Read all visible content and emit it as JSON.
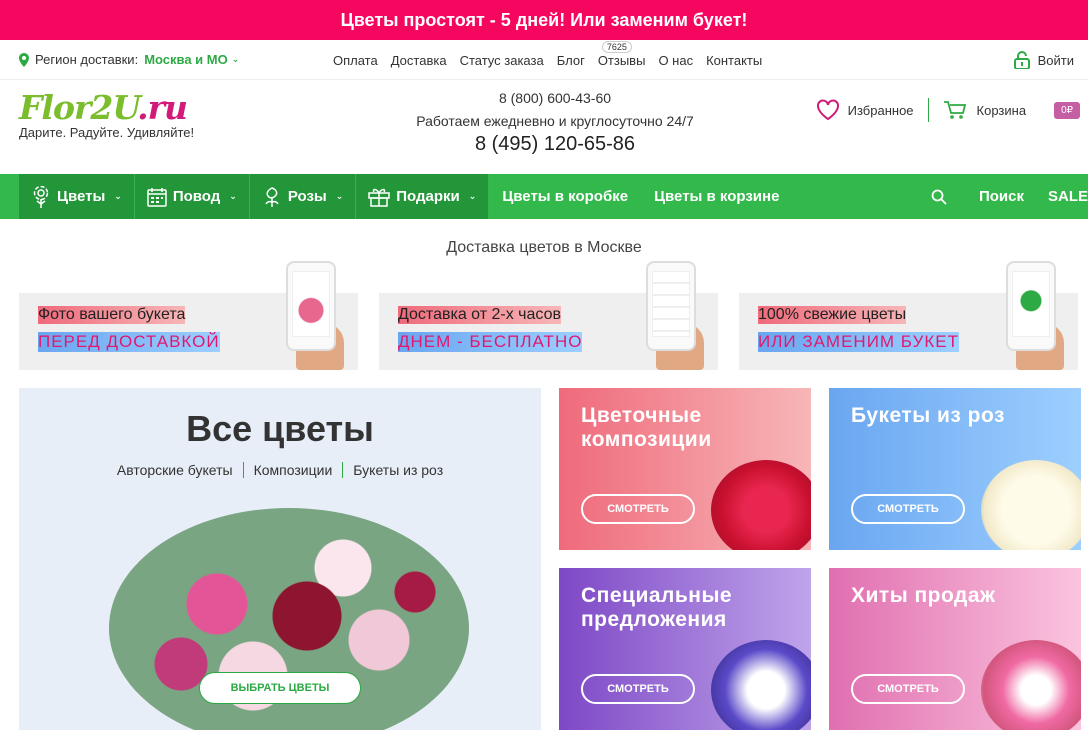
{
  "promo": {
    "text": "Цветы простоят - 5 дней! Или заменим букет!"
  },
  "topbar": {
    "region_label": "Регион доставки:",
    "region_value": "Москва и МО",
    "nav": [
      "Оплата",
      "Доставка",
      "Статус заказа",
      "Блог",
      "Отзывы",
      "О нас",
      "Контакты"
    ],
    "reviews_count": "7625",
    "login": "Войти"
  },
  "header": {
    "logo_main": "Flor2U",
    "logo_suffix": ".ru",
    "slogan": "Дарите. Радуйте. Удивляйте!",
    "phone_free": "8 (800) 600-43-60",
    "hours": "Работаем ежедневно и круглосуточно 24/7",
    "phone_main": "8 (495) 120-65-86",
    "favorites": "Избранное",
    "cart": "Корзина",
    "cart_total": "0₽"
  },
  "mainnav": {
    "items": [
      "Цветы",
      "Повод",
      "Розы",
      "Подарки"
    ],
    "plain": [
      "Цветы в коробке",
      "Цветы в корзине"
    ],
    "search": "Поиск",
    "sale": "SALE"
  },
  "page": {
    "subtitle": "Доставка цветов в Москве"
  },
  "features": [
    {
      "line1": "Фото вашего букета",
      "line2": "ПЕРЕД ДОСТАВКОЙ"
    },
    {
      "line1": "Доставка от 2-х часов",
      "line2": "ДНЕМ - БЕСПЛАТНО"
    },
    {
      "line1": "100% свежие цветы",
      "line2": "ИЛИ ЗАМЕНИМ БУКЕТ"
    }
  ],
  "allflowers": {
    "title": "Все цветы",
    "links": [
      "Авторские букеты",
      "Композиции",
      "Букеты из роз"
    ],
    "button": "ВЫБРАТЬ ЦВЕТЫ"
  },
  "tiles": [
    {
      "title": "Цветочные композиции",
      "button": "СМОТРЕТЬ"
    },
    {
      "title": "Букеты из роз",
      "button": "СМОТРЕТЬ"
    },
    {
      "title": "Специальные предложения",
      "button": "СМОТРЕТЬ"
    },
    {
      "title": "Хиты продаж",
      "button": "СМОТРЕТЬ"
    }
  ],
  "colors": {
    "promo": "#f5075f",
    "green": "#33b94b",
    "accent_pink": "#e2186f"
  }
}
